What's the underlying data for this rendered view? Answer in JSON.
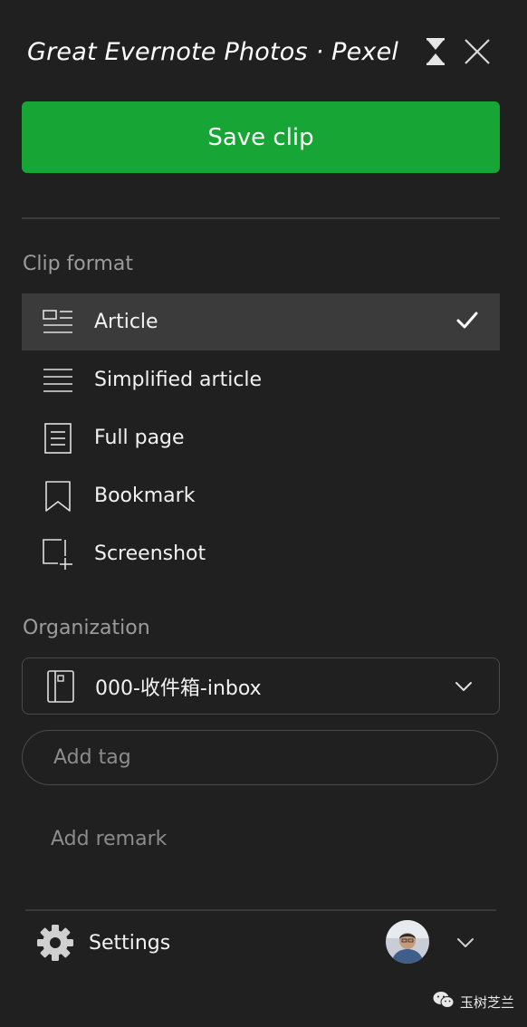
{
  "header": {
    "title": "Great Evernote Photos · Pexels ·",
    "collapse_icon": "hourglass-collapse-icon",
    "close_icon": "close-icon"
  },
  "save_button": {
    "label": "Save clip",
    "color": "#17a535"
  },
  "clip_format": {
    "label": "Clip format",
    "selected": "Article",
    "items": [
      {
        "label": "Article",
        "icon": "article-icon",
        "selected": true
      },
      {
        "label": "Simplified article",
        "icon": "simplified-article-icon",
        "selected": false
      },
      {
        "label": "Full page",
        "icon": "full-page-icon",
        "selected": false
      },
      {
        "label": "Bookmark",
        "icon": "bookmark-icon",
        "selected": false
      },
      {
        "label": "Screenshot",
        "icon": "screenshot-icon",
        "selected": false
      }
    ]
  },
  "organization": {
    "label": "Organization",
    "notebook": "000-收件箱-inbox",
    "tag_placeholder": "Add tag",
    "remark_placeholder": "Add remark"
  },
  "footer": {
    "settings_label": "Settings",
    "settings_icon": "gear-icon",
    "avatar": "user-avatar"
  },
  "watermark": {
    "text": "玉树芝兰"
  }
}
